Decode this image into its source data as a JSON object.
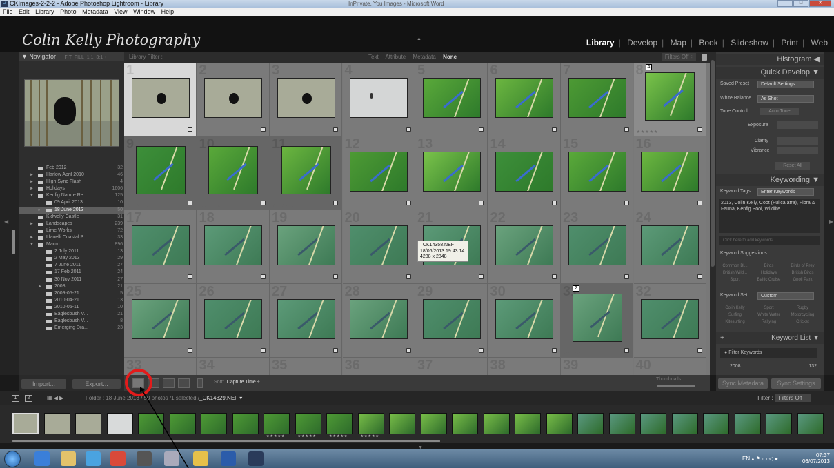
{
  "window": {
    "title": "CKImages-2-2-2 - Adobe Photoshop Lightroom - Library",
    "other_title": "InPrivate, You Images - Microsoft Word",
    "buttons": [
      "–",
      "□",
      "✕"
    ]
  },
  "menu": [
    "File",
    "Edit",
    "Library",
    "Photo",
    "Metadata",
    "View",
    "Window",
    "Help"
  ],
  "identity_plate": "Colin Kelly Photography",
  "modules": [
    "Library",
    "Develop",
    "Map",
    "Book",
    "Slideshow",
    "Print",
    "Web"
  ],
  "active_module": "Library",
  "navigator": {
    "title": "Navigator",
    "options": [
      "FIT",
      "FILL",
      "1:1",
      "3:1"
    ]
  },
  "folders": [
    {
      "label": "Feb 2012",
      "count": "32",
      "indent": 1,
      "twisty": ""
    },
    {
      "label": "Harlow April 2010",
      "count": "46",
      "indent": 1,
      "twisty": "►"
    },
    {
      "label": "High Sync Flash",
      "count": "4",
      "indent": 1,
      "twisty": "►"
    },
    {
      "label": "Holidays",
      "count": "1606",
      "indent": 1,
      "twisty": "►"
    },
    {
      "label": "Kenfig Nature Re...",
      "count": "125",
      "indent": 1,
      "twisty": "▼"
    },
    {
      "label": "09 April 2013",
      "count": "10",
      "indent": 2,
      "twisty": ""
    },
    {
      "label": "18 June 2013",
      "count": "50",
      "indent": 2,
      "twisty": "»",
      "selected": true
    },
    {
      "label": "Kidwelly Castle",
      "count": "31",
      "indent": 1,
      "twisty": ""
    },
    {
      "label": "Landscapes",
      "count": "239",
      "indent": 1,
      "twisty": "►"
    },
    {
      "label": "Lime Works",
      "count": "72",
      "indent": 1,
      "twisty": ""
    },
    {
      "label": "Llanelli Coastal P...",
      "count": "33",
      "indent": 1,
      "twisty": "►"
    },
    {
      "label": "Macro",
      "count": "896",
      "indent": 1,
      "twisty": "▼"
    },
    {
      "label": "2 July 2011",
      "count": "13",
      "indent": 2,
      "twisty": ""
    },
    {
      "label": "2 May 2013",
      "count": "29",
      "indent": 2,
      "twisty": ""
    },
    {
      "label": "7 June 2011",
      "count": "27",
      "indent": 2,
      "twisty": ""
    },
    {
      "label": "17 Feb 2011",
      "count": "24",
      "indent": 2,
      "twisty": ""
    },
    {
      "label": "30 Nov 2011",
      "count": "27",
      "indent": 2,
      "twisty": ""
    },
    {
      "label": "2008",
      "count": "21",
      "indent": 2,
      "twisty": "►"
    },
    {
      "label": "2009-05-21",
      "count": "5",
      "indent": 2,
      "twisty": ""
    },
    {
      "label": "2010-04-21",
      "count": "13",
      "indent": 2,
      "twisty": ""
    },
    {
      "label": "2010-05-11",
      "count": "10",
      "indent": 2,
      "twisty": ""
    },
    {
      "label": "Eaglesbush V...",
      "count": "21",
      "indent": 2,
      "twisty": ""
    },
    {
      "label": "Eaglesbush V...",
      "count": "8",
      "indent": 2,
      "twisty": ""
    },
    {
      "label": "Emerging Dra...",
      "count": "23",
      "indent": 2,
      "twisty": ""
    }
  ],
  "left_buttons": {
    "import": "Import...",
    "export": "Export..."
  },
  "filter_bar": {
    "label": "Library Filter :",
    "options": [
      "Text",
      "Attribute",
      "Metadata"
    ],
    "active": "None",
    "filters_off": "Filters Off ÷"
  },
  "grid_numbers": [
    "1",
    "2",
    "3",
    "4",
    "5",
    "6",
    "7",
    "8",
    "9",
    "10",
    "11",
    "12",
    "13",
    "14",
    "15",
    "16",
    "17",
    "18",
    "19",
    "20",
    "21",
    "22",
    "23",
    "24",
    "25",
    "26",
    "27",
    "28",
    "29",
    "30",
    "31",
    "32",
    "33",
    "34",
    "35",
    "36",
    "37",
    "38",
    "39",
    "40"
  ],
  "cell_flags": {
    "8": "4",
    "31": "2"
  },
  "tooltip": {
    "filename": "_CK14358.NEF",
    "datetime": "18/06/2013 19:43:14",
    "size": "4288 x 2848"
  },
  "right_panel": {
    "histogram": "Histogram",
    "quick_develop": "Quick Develop",
    "saved_preset_label": "Saved Preset",
    "saved_preset_value": "Default Settings",
    "white_balance_label": "White Balance",
    "white_balance_value": "As Shot",
    "tone_control_label": "Tone Control",
    "auto_tone": "Auto Tone",
    "exposure_label": "Exposure",
    "clarity_label": "Clarity",
    "vibrance_label": "Vibrance",
    "reset_all": "Reset All",
    "keywording": "Keywording",
    "keyword_tags_label": "Keyword Tags",
    "keyword_tags_value": "Enter Keywords",
    "keywords_text": "2013, Colin Kelly, Coot (Fulica atra), Flora & Fauna, Kenfig Pool, Wildlife",
    "add_keywords_hint": "Click here to add keywords",
    "keyword_suggestions": "Keyword Suggestions",
    "suggestions": [
      "Common Bl...",
      "Birds",
      "Birds of Prey",
      "British Wild...",
      "Holidays",
      "British Birds",
      "Sport",
      "Baltic Cruise",
      "Gnoll Park"
    ],
    "keyword_set_label": "Keyword Set",
    "keyword_set_value": "Custom",
    "set_keywords": [
      "Colin Kelly",
      "Sport",
      "Rugby",
      "Surfing",
      "White Water",
      "Motorcycling",
      "Kitesurfing",
      "Rallying",
      "Cricket"
    ],
    "keyword_list": "Keyword List",
    "filter_keywords": "Filter Keywords",
    "kw_row_label": "2008",
    "kw_row_count": "132"
  },
  "toolbar": {
    "sort_label": "Sort:",
    "sort_value": "Capture Time ÷",
    "thumbnails": "Thumbnails"
  },
  "sync": {
    "metadata": "Sync Metadata",
    "settings": "Sync Settings"
  },
  "filmstrip_header": {
    "page1": "1",
    "page2": "2",
    "folder_prefix": "Folder : 18 June 2013",
    "count": "50 photos /1 selected /",
    "filename": "_CK14329.NEF ▾",
    "filter_label": "Filter :",
    "filter_value": "Filters Off"
  },
  "tray": {
    "lang": "EN",
    "time": "07:37",
    "date": "06/07/2013"
  },
  "colors": {
    "annotation_red": "#e31b1b",
    "selected_cell": "#9a9a9a",
    "accent": "#dddddd"
  }
}
